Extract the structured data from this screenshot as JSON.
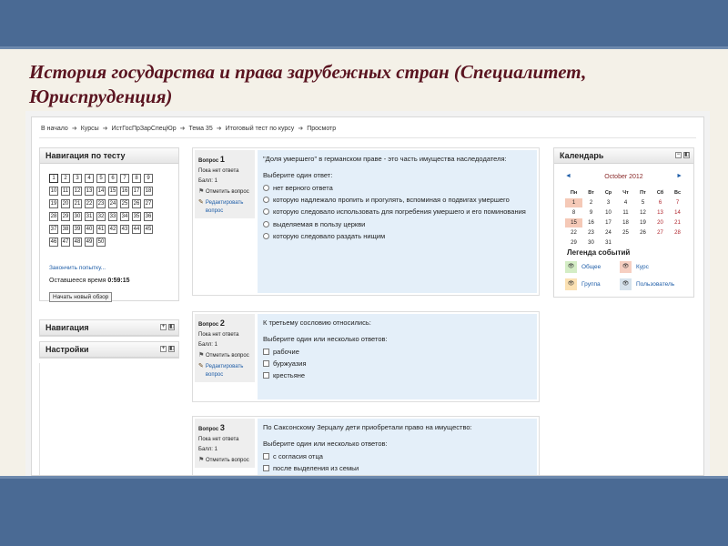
{
  "slide": {
    "title": "История государства и права зарубежных стран (Специалитет, Юриспруденция)"
  },
  "breadcrumb": [
    "В начало",
    "Курсы",
    "ИстГосПрЗарСпецЮр",
    "Тема 35",
    "Итоговый тест по курсу",
    "Просмотр"
  ],
  "quiz_nav": {
    "title": "Навигация по тесту",
    "buttons": [
      "1",
      "2",
      "3",
      "4",
      "5",
      "6",
      "7",
      "8",
      "9",
      "10",
      "11",
      "12",
      "13",
      "14",
      "15",
      "16",
      "17",
      "18",
      "19",
      "20",
      "21",
      "22",
      "23",
      "24",
      "25",
      "26",
      "27",
      "28",
      "29",
      "30",
      "31",
      "32",
      "33",
      "34",
      "35",
      "36",
      "37",
      "38",
      "39",
      "40",
      "41",
      "42",
      "43",
      "44",
      "45",
      "46",
      "47",
      "48",
      "49",
      "50"
    ],
    "finish_link": "Закончить попытку...",
    "time_label": "Оставшееся время",
    "time_value": "0:59:15",
    "new_preview": "Начать новый обзор"
  },
  "blocks": {
    "navigation": "Навигация",
    "settings": "Настройки"
  },
  "questions": [
    {
      "label": "Вопрос",
      "number": "1",
      "status": "Пока нет ответа",
      "marks": "Балл: 1",
      "flag": "Отметить вопрос",
      "edit": "Редактировать вопрос",
      "type": "radio",
      "prompt": "\"Доля умершего\" в германском праве - это часть имущества наследодателя:",
      "instruction": "Выберите один ответ:",
      "options": [
        "нет верного ответа",
        "которую надлежало пропить и прогулять, вспоминая о подвигах умершего",
        "которую следовало использовать для погребения умершего и его поминования",
        "выделяемая в пользу церкви",
        "которую следовало раздать нищим"
      ]
    },
    {
      "label": "Вопрос",
      "number": "2",
      "status": "Пока нет ответа",
      "marks": "Балл: 1",
      "flag": "Отметить вопрос",
      "edit": "Редактировать вопрос",
      "type": "checkbox",
      "prompt": "К третьему сословию относились:",
      "instruction": "Выберите один или несколько ответов:",
      "options": [
        "рабочие",
        "буржуазия",
        "крестьяне"
      ]
    },
    {
      "label": "Вопрос",
      "number": "3",
      "status": "Пока нет ответа",
      "marks": "Балл: 1",
      "flag": "Отметить вопрос",
      "type": "checkbox",
      "prompt": "По Саксонскому Зерцалу дети приобретали право на имущество:",
      "instruction": "Выберите один или несколько ответов:",
      "options": [
        "с согласия отца",
        "после выделения из семьи"
      ]
    }
  ],
  "calendar": {
    "title": "Календарь",
    "month": "October 2012",
    "prev": "◄",
    "next": "►",
    "weekdays": [
      "Пн",
      "Вт",
      "Ср",
      "Чт",
      "Пт",
      "Сб",
      "Вс"
    ],
    "cells": [
      "1",
      "2",
      "3",
      "4",
      "5",
      "6",
      "7",
      "8",
      "9",
      "10",
      "11",
      "12",
      "13",
      "14",
      "15",
      "16",
      "17",
      "18",
      "19",
      "20",
      "21",
      "22",
      "23",
      "24",
      "25",
      "26",
      "27",
      "28",
      "29",
      "30",
      "31",
      "",
      "",
      "",
      "",
      ""
    ],
    "highlighted": [
      "1",
      "15"
    ],
    "weekend_color": "#b0252d",
    "legend_title": "Легенда событий",
    "legend": [
      {
        "label": "Общее",
        "key": "general",
        "icon": "eye-icon",
        "color": "#d4edc5"
      },
      {
        "label": "Курс",
        "key": "course",
        "icon": "eye-icon",
        "color": "#f6cfc1"
      },
      {
        "label": "Группа",
        "key": "group",
        "icon": "eye-icon",
        "color": "#fbe1b3"
      },
      {
        "label": "Пользователь",
        "key": "user",
        "icon": "eye-icon",
        "color": "#d6e2ec"
      }
    ]
  },
  "colors": {
    "band": "#4a6a94",
    "title": "#5a1420",
    "question_bg": "#e4eff9",
    "link": "#1f5ea8"
  }
}
